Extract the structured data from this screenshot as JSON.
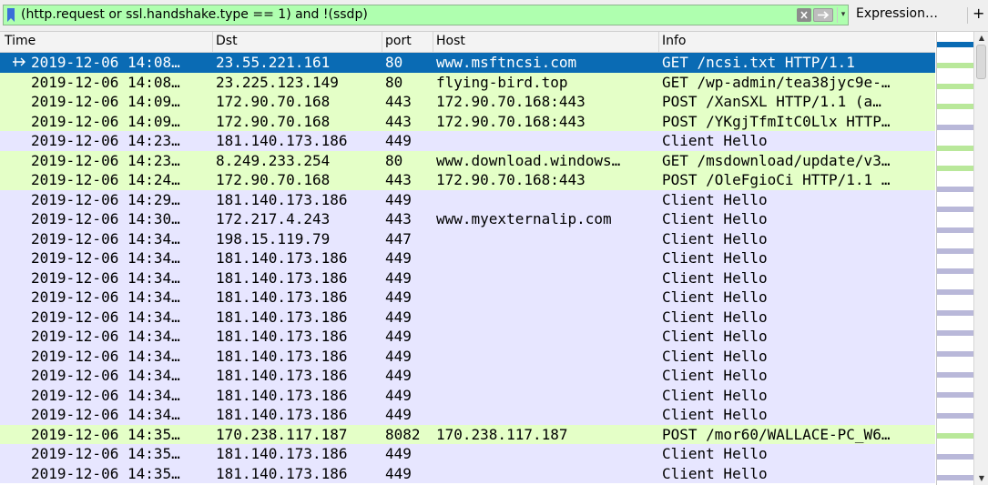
{
  "filter": {
    "expression": "(http.request or ssl.handshake.type == 1) and !(ssdp)",
    "expression_button": "Expression…",
    "add_button": "+"
  },
  "columns": {
    "time": "Time",
    "dst": "Dst",
    "port": "port",
    "host": "Host",
    "info": "Info"
  },
  "colors": {
    "http_row": "#e4ffc7",
    "tls_row": "#e7e6ff",
    "selected_row": "#0a6bb4",
    "filter_valid": "#afffaf"
  },
  "packets": [
    {
      "time": "2019-12-06 14:08…",
      "dst": "23.55.221.161",
      "port": "80",
      "host": "www.msftncsi.com",
      "info": "GET /ncsi.txt HTTP/1.1",
      "kind": "http",
      "selected": true
    },
    {
      "time": "2019-12-06 14:08…",
      "dst": "23.225.123.149",
      "port": "80",
      "host": "flying-bird.top",
      "info": "GET /wp-admin/tea38jyc9e-…",
      "kind": "http"
    },
    {
      "time": "2019-12-06 14:09…",
      "dst": "172.90.70.168",
      "port": "443",
      "host": "172.90.70.168:443",
      "info": "POST /XanSXL HTTP/1.1  (a…",
      "kind": "http"
    },
    {
      "time": "2019-12-06 14:09…",
      "dst": "172.90.70.168",
      "port": "443",
      "host": "172.90.70.168:443",
      "info": "POST /YKgjTfmItC0Llx HTTP…",
      "kind": "http"
    },
    {
      "time": "2019-12-06 14:23…",
      "dst": "181.140.173.186",
      "port": "449",
      "host": "",
      "info": "Client Hello",
      "kind": "tls"
    },
    {
      "time": "2019-12-06 14:23…",
      "dst": "8.249.233.254",
      "port": "80",
      "host": "www.download.windows…",
      "info": "GET /msdownload/update/v3…",
      "kind": "http"
    },
    {
      "time": "2019-12-06 14:24…",
      "dst": "172.90.70.168",
      "port": "443",
      "host": "172.90.70.168:443",
      "info": "POST /OleFgioCi HTTP/1.1 …",
      "kind": "http"
    },
    {
      "time": "2019-12-06 14:29…",
      "dst": "181.140.173.186",
      "port": "449",
      "host": "",
      "info": "Client Hello",
      "kind": "tls"
    },
    {
      "time": "2019-12-06 14:30…",
      "dst": "172.217.4.243",
      "port": "443",
      "host": "www.myexternalip.com",
      "info": "Client Hello",
      "kind": "tls"
    },
    {
      "time": "2019-12-06 14:34…",
      "dst": "198.15.119.79",
      "port": "447",
      "host": "",
      "info": "Client Hello",
      "kind": "tls"
    },
    {
      "time": "2019-12-06 14:34…",
      "dst": "181.140.173.186",
      "port": "449",
      "host": "",
      "info": "Client Hello",
      "kind": "tls"
    },
    {
      "time": "2019-12-06 14:34…",
      "dst": "181.140.173.186",
      "port": "449",
      "host": "",
      "info": "Client Hello",
      "kind": "tls"
    },
    {
      "time": "2019-12-06 14:34…",
      "dst": "181.140.173.186",
      "port": "449",
      "host": "",
      "info": "Client Hello",
      "kind": "tls"
    },
    {
      "time": "2019-12-06 14:34…",
      "dst": "181.140.173.186",
      "port": "449",
      "host": "",
      "info": "Client Hello",
      "kind": "tls"
    },
    {
      "time": "2019-12-06 14:34…",
      "dst": "181.140.173.186",
      "port": "449",
      "host": "",
      "info": "Client Hello",
      "kind": "tls"
    },
    {
      "time": "2019-12-06 14:34…",
      "dst": "181.140.173.186",
      "port": "449",
      "host": "",
      "info": "Client Hello",
      "kind": "tls"
    },
    {
      "time": "2019-12-06 14:34…",
      "dst": "181.140.173.186",
      "port": "449",
      "host": "",
      "info": "Client Hello",
      "kind": "tls"
    },
    {
      "time": "2019-12-06 14:34…",
      "dst": "181.140.173.186",
      "port": "449",
      "host": "",
      "info": "Client Hello",
      "kind": "tls"
    },
    {
      "time": "2019-12-06 14:34…",
      "dst": "181.140.173.186",
      "port": "449",
      "host": "",
      "info": "Client Hello",
      "kind": "tls"
    },
    {
      "time": "2019-12-06 14:35…",
      "dst": "170.238.117.187",
      "port": "8082",
      "host": "170.238.117.187",
      "info": "POST /mor60/WALLACE-PC_W6…",
      "kind": "http"
    },
    {
      "time": "2019-12-06 14:35…",
      "dst": "181.140.173.186",
      "port": "449",
      "host": "",
      "info": "Client Hello",
      "kind": "tls"
    },
    {
      "time": "2019-12-06 14:35…",
      "dst": "181.140.173.186",
      "port": "449",
      "host": "",
      "info": "Client Hello",
      "kind": "tls"
    }
  ]
}
